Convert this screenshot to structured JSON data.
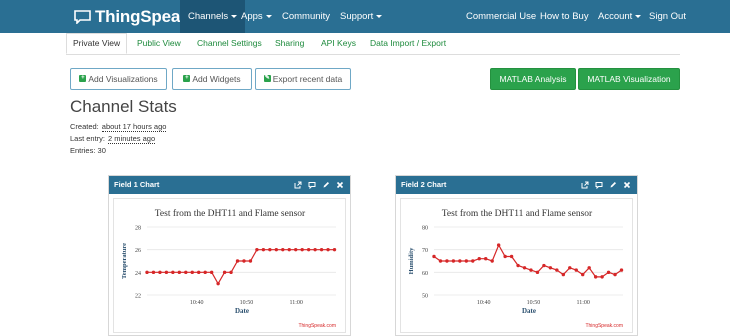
{
  "nav": {
    "logo": "ThingSpeak",
    "logo_tm": "™",
    "items": [
      {
        "label": "Channels",
        "caret": true,
        "active": true
      },
      {
        "label": "Apps",
        "caret": true
      },
      {
        "label": "Community"
      },
      {
        "label": "Support",
        "caret": true
      }
    ],
    "right_items": [
      {
        "label": "Commercial Use"
      },
      {
        "label": "How to Buy"
      },
      {
        "label": "Account",
        "caret": true
      },
      {
        "label": "Sign Out"
      }
    ]
  },
  "tabs": [
    "Private View",
    "Public View",
    "Channel Settings",
    "Sharing",
    "API Keys",
    "Data Import / Export"
  ],
  "active_tab": "Private View",
  "buttons": {
    "add_visualizations": "Add Visualizations",
    "add_widgets": "Add Widgets",
    "export_data": "Export recent data",
    "matlab_analysis": "MATLAB Analysis",
    "matlab_visualization": "MATLAB Visualization"
  },
  "stats": {
    "title": "Channel Stats",
    "created_label": "Created:",
    "created_value": "about 17 hours ago",
    "last_entry_label": "Last entry:",
    "last_entry_value": "2 minutes ago",
    "entries_label": "Entries:",
    "entries_value": "30"
  },
  "colors": {
    "nav_bg": "#2a6f93",
    "accent_green": "#2ba24c",
    "series_red": "#d62728"
  },
  "chart_data": [
    {
      "panel_title": "Field 1 Chart",
      "type": "line",
      "title": "Test from the DHT11 and Flame sensor",
      "xlabel": "Date",
      "ylabel": "Temperature",
      "credit": "ThingSpeak.com",
      "ylim": [
        22,
        28
      ],
      "yticks": [
        22,
        24,
        26,
        28
      ],
      "xlim": [
        30,
        68
      ],
      "xticks": [
        {
          "v": 40,
          "label": "10:40"
        },
        {
          "v": 50,
          "label": "10:50"
        },
        {
          "v": 60,
          "label": "11:00"
        }
      ],
      "x": [
        30,
        31.3,
        32.6,
        33.9,
        35.2,
        36.5,
        37.8,
        39.1,
        40.4,
        41.7,
        43.0,
        44.3,
        45.6,
        46.9,
        48.2,
        49.5,
        50.8,
        52.1,
        53.4,
        54.7,
        56.0,
        57.3,
        58.6,
        59.9,
        61.2,
        62.5,
        63.8,
        65.1,
        66.4,
        67.7
      ],
      "series": [
        {
          "values": [
            24,
            24,
            24,
            24,
            24,
            24,
            24,
            24,
            24,
            24,
            24,
            23,
            24,
            24,
            25,
            25,
            25,
            26,
            26,
            26,
            26,
            26,
            26,
            26,
            26,
            26,
            26,
            26,
            26,
            26
          ]
        }
      ]
    },
    {
      "panel_title": "Field 2 Chart",
      "type": "line",
      "title": "Test from the DHT11 and Flame sensor",
      "xlabel": "Date",
      "ylabel": "Humidity",
      "credit": "ThingSpeak.com",
      "ylim": [
        50,
        80
      ],
      "yticks": [
        50,
        60,
        70,
        80
      ],
      "xlim": [
        30,
        68
      ],
      "xticks": [
        {
          "v": 40,
          "label": "10:40"
        },
        {
          "v": 50,
          "label": "10:50"
        },
        {
          "v": 60,
          "label": "11:00"
        }
      ],
      "x": [
        30,
        31.3,
        32.6,
        33.9,
        35.2,
        36.5,
        37.8,
        39.1,
        40.4,
        41.7,
        43.0,
        44.3,
        45.6,
        46.9,
        48.2,
        49.5,
        50.8,
        52.1,
        53.4,
        54.7,
        56.0,
        57.3,
        58.6,
        59.9,
        61.2,
        62.5,
        63.8,
        65.1,
        66.4,
        67.7
      ],
      "series": [
        {
          "values": [
            67,
            65,
            65,
            65,
            65,
            65,
            65,
            66,
            66,
            65,
            72,
            67,
            67,
            63,
            62,
            61,
            60,
            63,
            62,
            61,
            59,
            62,
            61,
            59,
            62,
            58,
            58,
            60,
            59,
            61
          ]
        }
      ]
    }
  ]
}
